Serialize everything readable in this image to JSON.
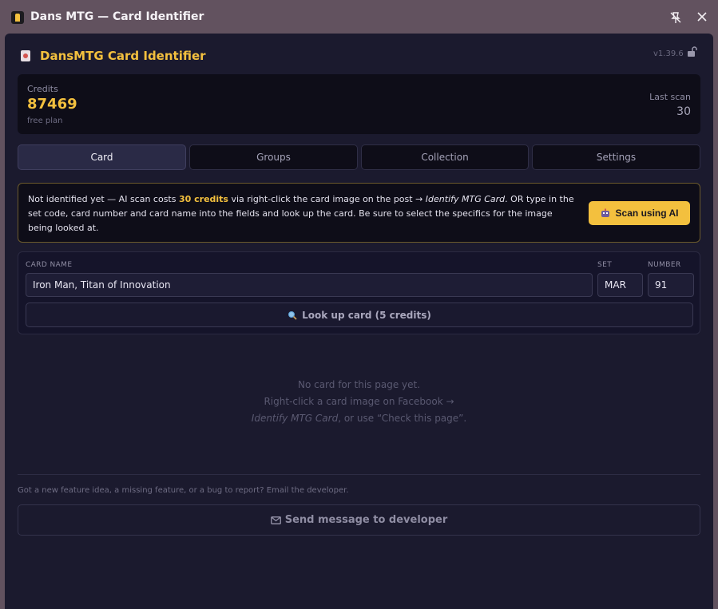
{
  "window": {
    "title": "Dans MTG — Card Identifier",
    "pin_icon": "pin-off-icon",
    "close_icon": "close-icon"
  },
  "header": {
    "title": "DansMTG Card Identifier",
    "version": "v1.39.6",
    "lock_icon": "unlock-icon"
  },
  "credits": {
    "label": "Credits",
    "value": "87469",
    "plan": "free plan",
    "last_scan_label": "Last scan",
    "last_scan_value": "30"
  },
  "tabs": [
    {
      "label": "Card",
      "active": true
    },
    {
      "label": "Groups",
      "active": false
    },
    {
      "label": "Collection",
      "active": false
    },
    {
      "label": "Settings",
      "active": false
    }
  ],
  "notice": {
    "text_prefix": "Not identified yet — AI scan costs ",
    "cost": "30 credits",
    "text_mid": " via right-click the card image on the post → ",
    "menu_item": "Identify MTG Card",
    "text_suffix": ". OR type in the set code, card number and card name into the fields and look up the card. Be sure to select the specifics for the image being looked at.",
    "scan_button": "Scan using AI"
  },
  "lookup": {
    "card_name_label": "CARD NAME",
    "card_name_value": "Iron Man, Titan of Innovation",
    "set_label": "SET",
    "set_value": "MAR",
    "number_label": "NUMBER",
    "number_value": "91",
    "button": "Look up card (5 credits)"
  },
  "empty_state": {
    "line1": "No card for this page yet.",
    "line2": "Right-click a card image on Facebook →",
    "line3_italic": "Identify MTG Card",
    "line3_rest": ", or use “Check this page”."
  },
  "feedback": {
    "text": "Got a new feature idea, a missing feature, or a bug to report? Email the developer.",
    "button": "Send message to developer"
  },
  "colors": {
    "accent": "#f3c03e",
    "panel": "#1b1a2e",
    "frame": "#62525f"
  }
}
